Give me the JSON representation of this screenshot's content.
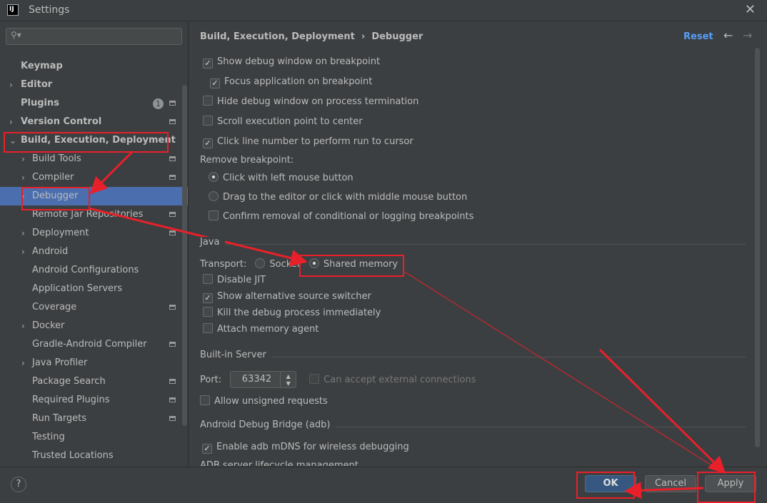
{
  "window": {
    "title": "Settings",
    "logo": "IJ"
  },
  "search": {
    "placeholder": ""
  },
  "sidebar": {
    "items": [
      {
        "label": "Keymap",
        "level": "top",
        "chevron": false
      },
      {
        "label": "Editor",
        "level": "top",
        "chevron": true
      },
      {
        "label": "Plugins",
        "level": "top",
        "chevron": false,
        "badge": "1",
        "gear": true
      },
      {
        "label": "Version Control",
        "level": "top",
        "chevron": true,
        "gear": true
      },
      {
        "label": "Build, Execution, Deployment",
        "level": "top",
        "chevron": true,
        "expanded": true
      },
      {
        "label": "Build Tools",
        "level": "sub",
        "chevron": true,
        "gear": true
      },
      {
        "label": "Compiler",
        "level": "sub",
        "chevron": true,
        "gear": true
      },
      {
        "label": "Debugger",
        "level": "sub",
        "chevron": true,
        "selected": true
      },
      {
        "label": "Remote Jar Repositories",
        "level": "sub",
        "gear": true
      },
      {
        "label": "Deployment",
        "level": "sub",
        "chevron": true,
        "gear": true
      },
      {
        "label": "Android",
        "level": "sub",
        "chevron": true
      },
      {
        "label": "Android Configurations",
        "level": "sub"
      },
      {
        "label": "Application Servers",
        "level": "sub"
      },
      {
        "label": "Coverage",
        "level": "sub",
        "gear": true
      },
      {
        "label": "Docker",
        "level": "sub",
        "chevron": true
      },
      {
        "label": "Gradle-Android Compiler",
        "level": "sub",
        "gear": true
      },
      {
        "label": "Java Profiler",
        "level": "sub",
        "chevron": true
      },
      {
        "label": "Package Search",
        "level": "sub",
        "gear": true
      },
      {
        "label": "Required Plugins",
        "level": "sub",
        "gear": true
      },
      {
        "label": "Run Targets",
        "level": "sub",
        "gear": true
      },
      {
        "label": "Testing",
        "level": "sub"
      },
      {
        "label": "Trusted Locations",
        "level": "sub"
      }
    ]
  },
  "header": {
    "breadcrumb_parent": "Build, Execution, Deployment",
    "breadcrumb_sep": "›",
    "breadcrumb_current": "Debugger",
    "reset": "Reset",
    "back": "←",
    "forward": "→"
  },
  "debugger": {
    "show_debug_window": {
      "label": "Show debug window on breakpoint",
      "checked": true
    },
    "focus_app": {
      "label": "Focus application on breakpoint",
      "checked": true
    },
    "hide_debug_window": {
      "label": "Hide debug window on process termination",
      "checked": false
    },
    "scroll_exec": {
      "label": "Scroll execution point to center",
      "checked": false
    },
    "click_line": {
      "label": "Click line number to perform run to cursor",
      "checked": true
    },
    "remove_bp_label": "Remove breakpoint:",
    "remove_left": {
      "label": "Click with left mouse button",
      "selected": true
    },
    "remove_drag": {
      "label": "Drag to the editor or click with middle mouse button",
      "selected": false
    },
    "confirm_removal": {
      "label": "Confirm removal of conditional or logging breakpoints",
      "checked": false
    }
  },
  "java": {
    "section": "Java",
    "transport_label": "Transport:",
    "socket": "Socket",
    "shared_memory": "Shared memory",
    "transport_selected": "Shared memory",
    "disable_jit": {
      "label": "Disable JIT",
      "checked": false
    },
    "alt_source": {
      "label": "Show alternative source switcher",
      "checked": true
    },
    "kill_debug": {
      "label": "Kill the debug process immediately",
      "checked": false
    },
    "memory_agent": {
      "label": "Attach memory agent",
      "checked": false
    }
  },
  "server": {
    "section": "Built-in Server",
    "port_label": "Port:",
    "port": "63342",
    "external": {
      "label": "Can accept external connections",
      "checked": false
    },
    "unsigned": {
      "label": "Allow unsigned requests",
      "checked": false
    }
  },
  "adb": {
    "section": "Android Debug Bridge (adb)",
    "mdns": {
      "label": "Enable adb mDNS for wireless debugging",
      "checked": true
    },
    "lifecycle": "ADB server lifecycle management"
  },
  "footer": {
    "help": "?",
    "ok": "OK",
    "cancel": "Cancel",
    "apply": "Apply"
  },
  "annotation_color": "#e8202a"
}
